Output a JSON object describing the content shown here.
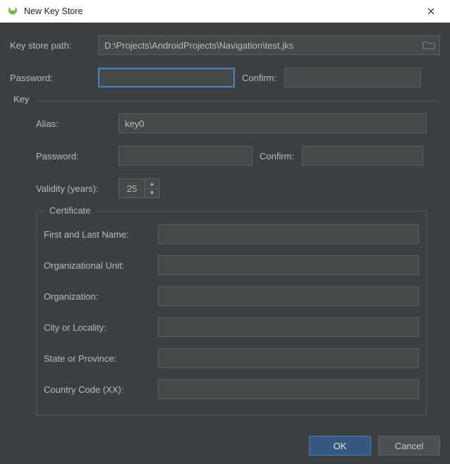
{
  "window": {
    "title": "New Key Store"
  },
  "keystore": {
    "path_label": "Key store path:",
    "path_value": "D:\\Projects\\AndroidProjects\\Navigation\\test.jks",
    "password_label": "Password:",
    "password_value": "",
    "confirm_label": "Confirm:",
    "confirm_value": ""
  },
  "key": {
    "group_label": "Key",
    "alias_label": "Alias:",
    "alias_value": "key0",
    "password_label": "Password:",
    "password_value": "",
    "confirm_label": "Confirm:",
    "confirm_value": "",
    "validity_label": "Validity (years):",
    "validity_value": "25"
  },
  "certificate": {
    "group_label": "Certificate",
    "first_last_label": "First and Last Name:",
    "first_last_value": "",
    "org_unit_label": "Organizational Unit:",
    "org_unit_value": "",
    "org_label": "Organization:",
    "org_value": "",
    "city_label": "City or Locality:",
    "city_value": "",
    "state_label": "State or Province:",
    "state_value": "",
    "country_label": "Country Code (XX):",
    "country_value": ""
  },
  "buttons": {
    "ok": "OK",
    "cancel": "Cancel"
  },
  "colors": {
    "panel_bg": "#3c3f41",
    "field_bg": "#45494a",
    "border": "#5b5e60",
    "focus": "#4a84c4",
    "primary_btn": "#365880"
  }
}
